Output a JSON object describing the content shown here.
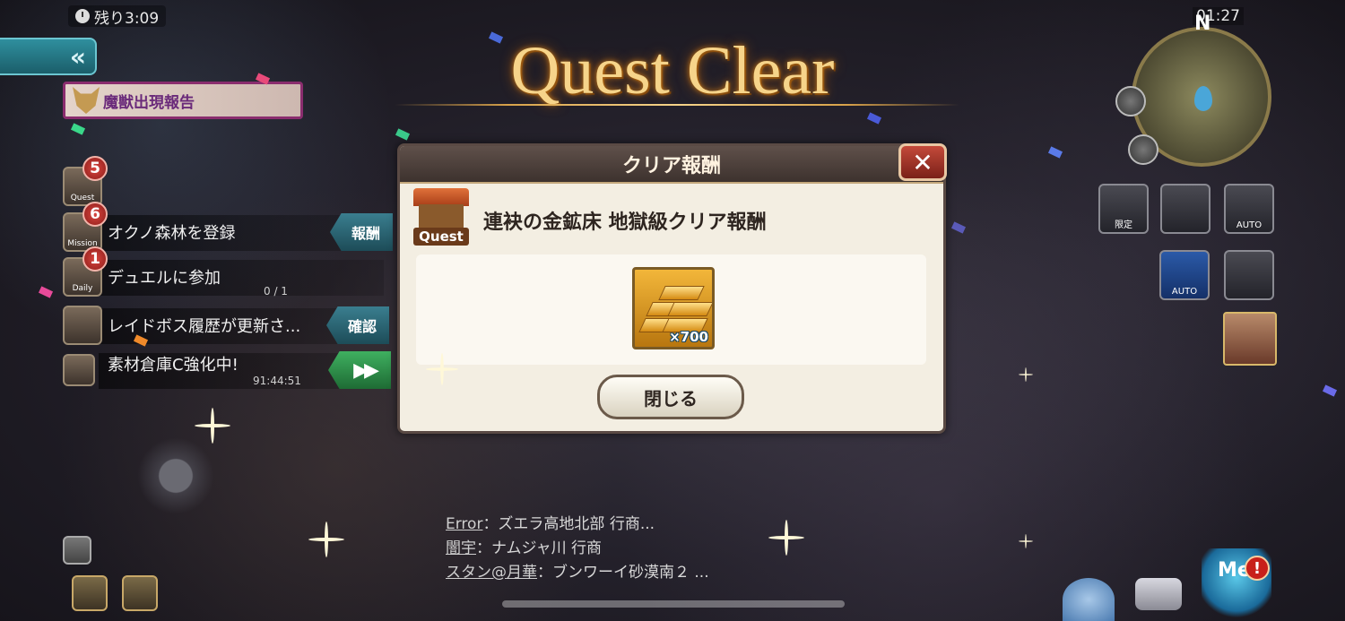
{
  "timer": {
    "label": "残り3:09"
  },
  "banner": {
    "beast_report": "魔獣出現報告"
  },
  "side_list": [
    {
      "icon_label": "Quest",
      "badge": "5",
      "text": "",
      "sub": ""
    },
    {
      "icon_label": "Mission",
      "badge": "6",
      "text": "オクノ森林を登録",
      "sub": "",
      "tag": "報酬"
    },
    {
      "icon_label": "Daily",
      "badge": "1",
      "text": "デュエルに参加",
      "sub": "0 / 1"
    },
    {
      "icon_label": "",
      "badge": "",
      "text": "レイドボス履歴が更新さ...",
      "sub": "",
      "tag": "確認"
    },
    {
      "icon_label": "",
      "badge": "",
      "text": "素材倉庫C強化中!",
      "sub": "91:44:51",
      "tag": "▶▶"
    }
  ],
  "title": "Quest Clear",
  "dialog": {
    "header": "クリア報酬",
    "close_symbol": "✕",
    "quest_badge": "Quest",
    "reward_title": "連袂の金鉱床 地獄級クリア報酬",
    "item_quantity": "×700",
    "close_button": "閉じる"
  },
  "map": {
    "time": "01:27",
    "north": "N"
  },
  "right_tools": [
    {
      "label": "限定",
      "icon": "hat-icon"
    },
    {
      "label": "",
      "icon": "camera-icon"
    },
    {
      "label": "AUTO",
      "icon": "auto-frame-icon"
    },
    {
      "label": "AUTO",
      "icon": "auto-speed-icon"
    },
    {
      "label": "",
      "icon": "party-icon"
    }
  ],
  "chat": [
    {
      "name": "Error",
      "message": "：ズエラ高地北部 行商..."
    },
    {
      "name": "闇宇",
      "message": "：ナムジャ川 行商"
    },
    {
      "name": "スタン@月華",
      "message": "：ブンワーイ砂漠南２ ..."
    }
  ],
  "bottom_right": {
    "me_label": "Me",
    "alert": "!"
  },
  "colors": {
    "title_gold": "#f6d48a",
    "dialog_bg": "#f3eee2",
    "header_bg": "#4d403b",
    "close_red": "#c44a3a"
  }
}
